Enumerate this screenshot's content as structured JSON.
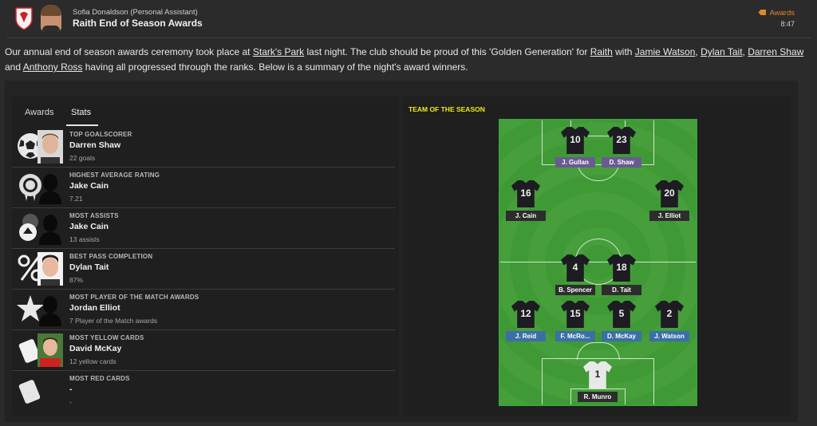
{
  "header": {
    "sender": "Sofia Donaldson  (Personal Assistant)",
    "subject": "Raith End of Season Awards",
    "tag": "Awards",
    "time": "8:47"
  },
  "intro": {
    "p1": "Our annual end of season awards ceremony took place at ",
    "link_stadium": "Stark's Park",
    "p2": " last night. The club should be proud of this 'Golden Generation' for ",
    "link_club": "Raith",
    "p3": " with ",
    "link_p1": "Jamie Watson",
    "sep1": ", ",
    "link_p2": "Dylan Tait",
    "sep2": ", ",
    "link_p3": "Darren Shaw",
    "p4": " and ",
    "link_p4": "Anthony Ross",
    "p5": " having all progressed through the ranks. Below is a summary of the night's award winners."
  },
  "tabs": {
    "awards": "Awards",
    "stats": "Stats",
    "active": "Stats"
  },
  "stats": [
    {
      "category": "Top Goalscorer",
      "player": "Darren Shaw",
      "value": "22 goals",
      "icon": "football-icon"
    },
    {
      "category": "Highest Average Rating",
      "player": "Jake Cain",
      "value": "7.21",
      "icon": "rating-badge-icon"
    },
    {
      "category": "Most Assists",
      "player": "Jake Cain",
      "value": "13 assists",
      "icon": "assist-icon"
    },
    {
      "category": "Best Pass Completion",
      "player": "Dylan Tait",
      "value": "87%",
      "icon": "percent-icon"
    },
    {
      "category": "Most Player of the Match Awards",
      "player": "Jordan Elliot",
      "value": "7 Player of the Match awards",
      "icon": "star-icon"
    },
    {
      "category": "Most Yellow Cards",
      "player": "David McKay",
      "value": "12 yellow cards",
      "icon": "yellow-card-icon"
    },
    {
      "category": "Most Red Cards",
      "player": "-",
      "value": "-",
      "icon": "red-card-icon"
    }
  ],
  "team_of_season": {
    "title": "TEAM OF THE SEASON",
    "players": [
      {
        "num": "10",
        "name": "J. Gullan",
        "label": "purple"
      },
      {
        "num": "23",
        "name": "D. Shaw",
        "label": "purple"
      },
      {
        "num": "16",
        "name": "J. Cain",
        "label": "dark"
      },
      {
        "num": "20",
        "name": "J. Elliot",
        "label": "dark"
      },
      {
        "num": "4",
        "name": "B. Spencer",
        "label": "dark"
      },
      {
        "num": "18",
        "name": "D. Tait",
        "label": "dark"
      },
      {
        "num": "12",
        "name": "J. Reid",
        "label": "blue"
      },
      {
        "num": "15",
        "name": "F. McRo...",
        "label": "blue"
      },
      {
        "num": "5",
        "name": "D. McKay",
        "label": "blue"
      },
      {
        "num": "2",
        "name": "J. Watson",
        "label": "blue"
      },
      {
        "num": "1",
        "name": "R. Munro",
        "label": "dark"
      }
    ]
  }
}
